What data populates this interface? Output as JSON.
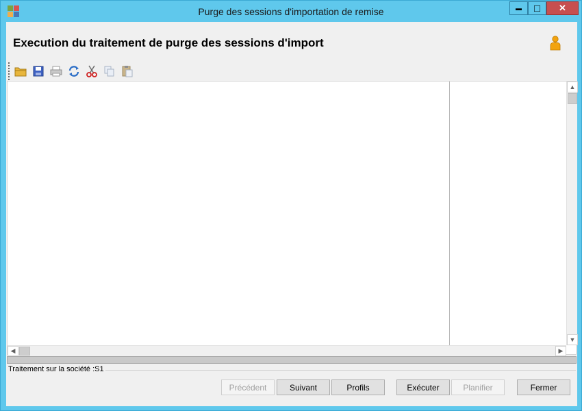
{
  "window": {
    "title": "Purge des sessions d'importation de remise",
    "controls": {
      "minimize": "▬",
      "maximize": "□",
      "close": "✕"
    }
  },
  "header": {
    "title": "Execution du traitement de purge des sessions d'import",
    "user_icon": "user-icon"
  },
  "toolbar": {
    "items": [
      {
        "name": "open-folder-icon"
      },
      {
        "name": "save-icon"
      },
      {
        "name": "print-icon",
        "disabled": true
      },
      {
        "name": "refresh-icon"
      },
      {
        "name": "cut-icon"
      },
      {
        "name": "copy-icon",
        "disabled": true
      },
      {
        "name": "paste-icon",
        "disabled": true
      }
    ]
  },
  "status": {
    "text": "Traitement sur la société :S1"
  },
  "buttons": {
    "precedent": {
      "label": "Précédent",
      "enabled": false
    },
    "suivant": {
      "label": "Suivant",
      "enabled": true
    },
    "profils": {
      "label": "Profils",
      "enabled": true
    },
    "executer": {
      "label": "Exécuter",
      "enabled": true
    },
    "planifier": {
      "label": "Planifier",
      "enabled": false
    },
    "fermer": {
      "label": "Fermer",
      "enabled": true
    }
  },
  "colors": {
    "title_bar": "#5fc8ec",
    "close_button": "#c74f4f",
    "client_background": "#f0f0f0"
  }
}
